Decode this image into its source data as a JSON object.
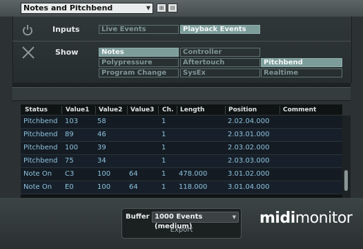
{
  "preset": {
    "name": "Notes and Pitchbend"
  },
  "filters": {
    "inputs_label": "Inputs",
    "show_label": "Show",
    "inputs": [
      {
        "label": "Live Events",
        "active": false
      },
      {
        "label": "Playback Events",
        "active": true
      }
    ],
    "show": [
      {
        "label": "Notes",
        "active": true
      },
      {
        "label": "Controller",
        "active": false
      },
      {
        "label": "Polypressure",
        "active": false
      },
      {
        "label": "Aftertouch",
        "active": false
      },
      {
        "label": "Pitchbend",
        "active": true
      },
      {
        "label": "Program Change",
        "active": false
      },
      {
        "label": "SysEx",
        "active": false
      },
      {
        "label": "Realtime",
        "active": false
      }
    ]
  },
  "table": {
    "columns": [
      "Status",
      "Value1",
      "Value2",
      "Value3",
      "Ch.",
      "Length",
      "Position",
      "Comment"
    ],
    "rows": [
      [
        "Pitchbend",
        "103",
        "58",
        "",
        "1",
        "",
        "2.02.04.000",
        ""
      ],
      [
        "Pitchbend",
        "89",
        "46",
        "",
        "1",
        "",
        "2.03.01.000",
        ""
      ],
      [
        "Pitchbend",
        "100",
        "39",
        "",
        "1",
        "",
        "2.03.02.000",
        ""
      ],
      [
        "Pitchbend",
        "75",
        "34",
        "",
        "1",
        "",
        "2.03.03.000",
        ""
      ],
      [
        "Note On",
        "C3",
        "100",
        "64",
        "1",
        "478.000",
        "3.01.02.000",
        ""
      ],
      [
        "Note On",
        "E0",
        "100",
        "64",
        "1",
        "118.000",
        "3.01.04.000",
        ""
      ]
    ]
  },
  "footer": {
    "buffer_label": "Buffer",
    "buffer_value": "1000 Events (medium)",
    "export_label": "Export",
    "brand_bold": "midi",
    "brand_light": "monitor"
  },
  "colors": {
    "accent": "#7d9d9b",
    "cell_text": "#8ec3df"
  }
}
